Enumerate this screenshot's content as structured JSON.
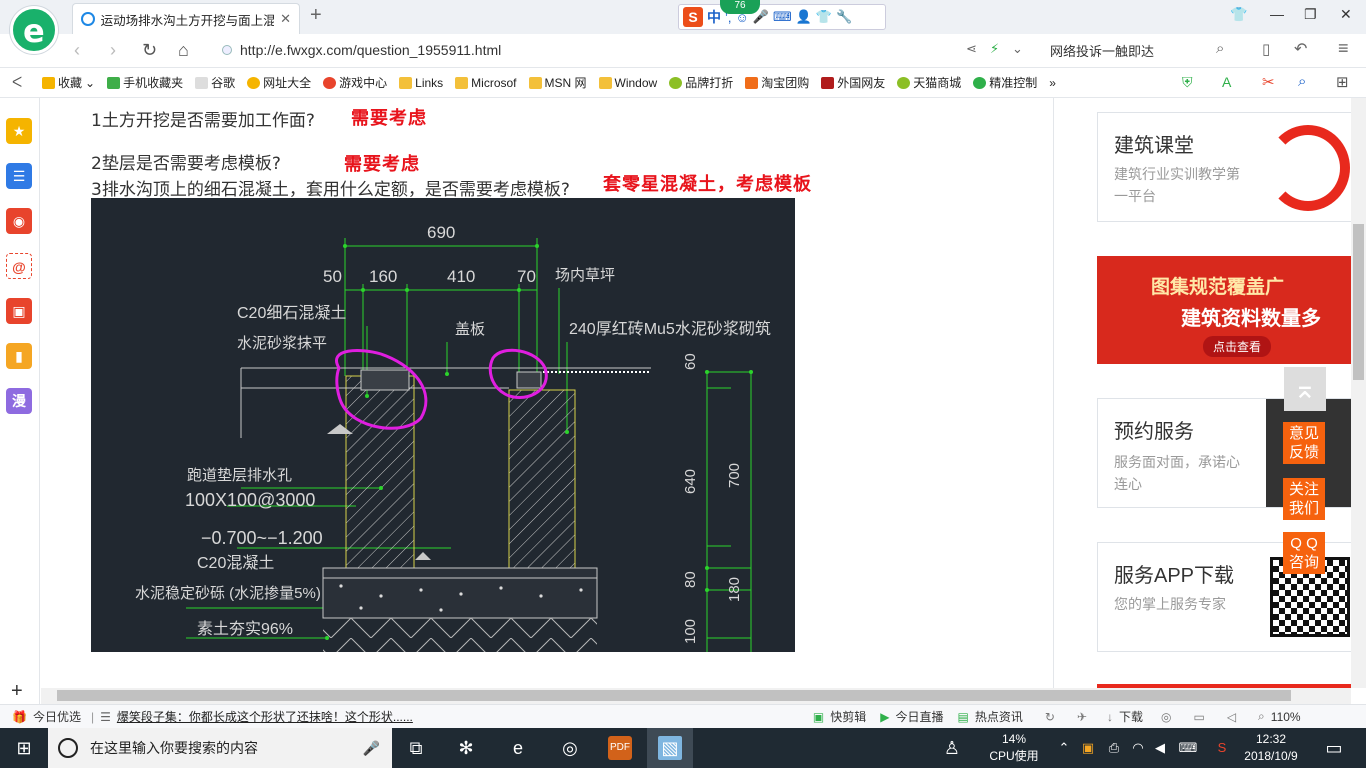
{
  "browser": {
    "tab_title": "运动场排水沟土方开挖与面上混凝",
    "new_tab": "+",
    "weather_temp": "76",
    "ime_lang": "中",
    "url": "http://e.fwxgx.com/question_1955911.html",
    "complaint_text": "网络投诉一触即达",
    "favorites": [
      {
        "label": "收藏",
        "color": "#f5b400"
      },
      {
        "label": "手机收藏夹",
        "color": "#3fae49"
      },
      {
        "label": "谷歌",
        "color": "#ccc"
      },
      {
        "label": "网址大全",
        "color": "#f5b400"
      },
      {
        "label": "游戏中心",
        "color": "#e8442c"
      },
      {
        "label": "Links",
        "color": "#f3c03a"
      },
      {
        "label": "Microsof",
        "color": "#f3c03a"
      },
      {
        "label": "MSN 网",
        "color": "#f3c03a"
      },
      {
        "label": "Window",
        "color": "#f3c03a"
      },
      {
        "label": "品牌打折",
        "color": "#8cbf26"
      },
      {
        "label": "淘宝团购",
        "color": "#f06d1a"
      },
      {
        "label": "外国网友",
        "color": "#b01c1c"
      },
      {
        "label": "天猫商城",
        "color": "#8cbf26"
      },
      {
        "label": "精准控制",
        "color": "#2fb04a"
      }
    ],
    "more": "»"
  },
  "question": {
    "q1": "1土方开挖是否需要加工作面?",
    "a1": "需要考虑",
    "q2": "2垫层是否需要考虑模板?",
    "a2": "需要考虑",
    "q3": "3排水沟顶上的细石混凝土，套用什么定额，是否需要考虑模板?",
    "a3": "套零星混凝土，考虑模板"
  },
  "drawing": {
    "dim_690": "690",
    "dim_50": "50",
    "dim_160": "160",
    "dim_410": "410",
    "dim_70": "70",
    "lawn": "场内草坪",
    "c20_fine": "C20细石混凝土",
    "mortar_level": "水泥砂浆抹平",
    "cover": "盖板",
    "brick_wall": "240厚红砖Mu5水泥砂浆砌筑",
    "dim_60": "60",
    "dim_640": "640",
    "dim_700": "700",
    "drain_hole": "跑道垫层排水孔",
    "drain_spec": "100X100@3000",
    "elev": "−0.700~−1.200",
    "c20": "C20混凝土",
    "gravel": "水泥稳定砂砾 (水泥掺量5%)",
    "soil": "素土夯实96%",
    "dim_80": "80",
    "dim_180": "180",
    "dim_100": "100"
  },
  "sidebar": {
    "card1_title": "建筑课堂",
    "card1_desc": "建筑行业实训教学第一平台",
    "banner_line1": "图集规范覆盖广",
    "banner_line2": "建筑资料数量多",
    "banner_btn": "点击查看",
    "card2_title": "预约服务",
    "card2_desc": "服务面对面，承诺心连心",
    "card3_title": "服务APP下载",
    "card3_desc": "您的掌上服务专家",
    "feedback": "意见反馈",
    "follow": "关注我们",
    "qq": "Q Q咨询"
  },
  "status": {
    "today": "今日优选",
    "news": "爆笑段子集：你都长成这个形状了还抹啥！这个形状......",
    "clip": "快剪辑",
    "live": "今日直播",
    "hot": "热点资讯",
    "download": "下载",
    "zoom": "110%"
  },
  "taskbar": {
    "search_placeholder": "在这里输入你要搜索的内容",
    "cpu_pct": "14%",
    "cpu_label": "CPU使用",
    "time": "12:32",
    "date": "2018/10/9"
  }
}
